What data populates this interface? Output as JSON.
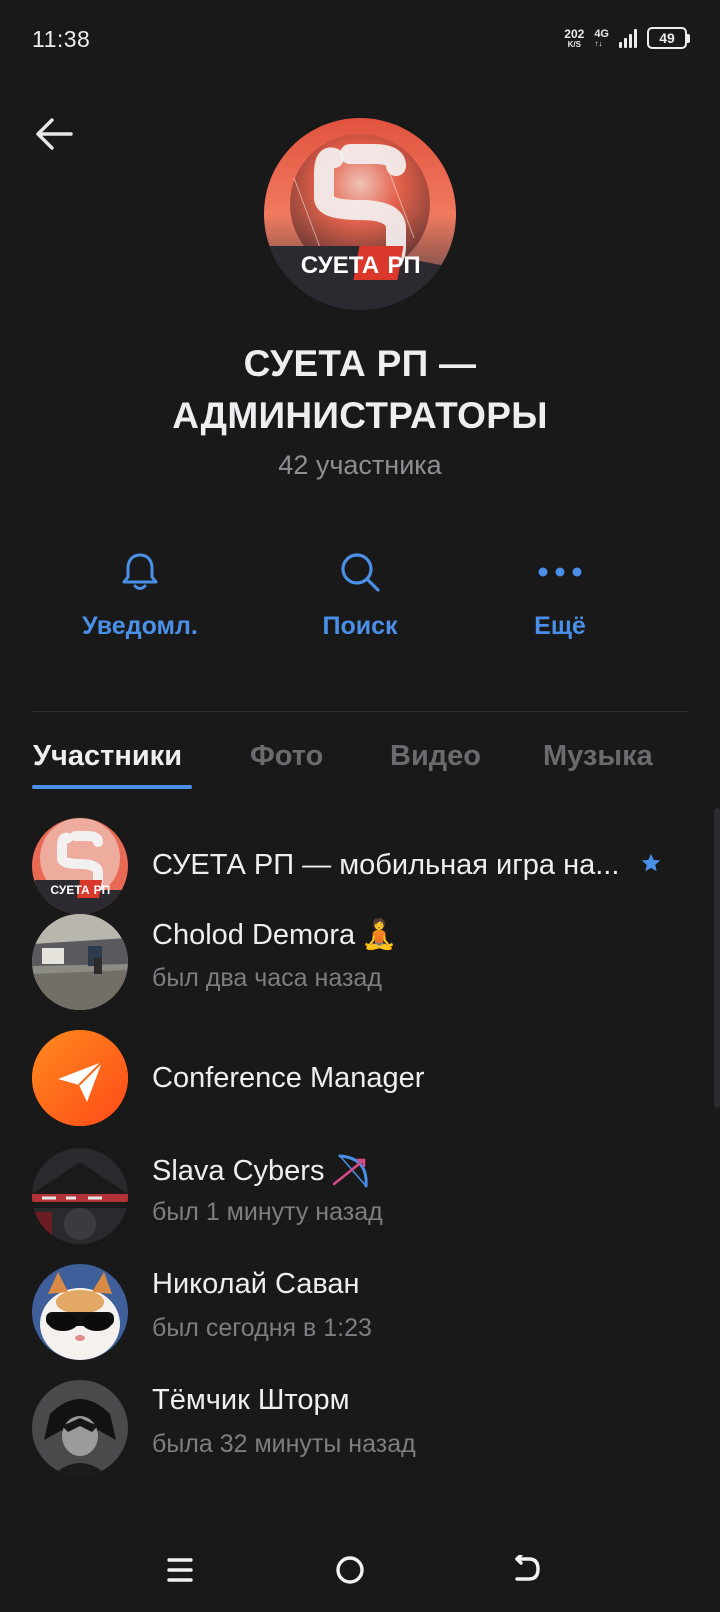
{
  "status_bar": {
    "time": "11:38",
    "net_speed": "202",
    "net_speed_unit": "K/S",
    "net_type": "4G",
    "net_arrows": "↑↓",
    "battery": "49"
  },
  "header": {
    "title": "СУЕТА РП — АДМИНИСТРАТОРЫ",
    "subtitle": "42 участника",
    "avatar_text": "СУЕТА",
    "avatar_text_accent": "РП"
  },
  "actions": [
    {
      "label": "Уведомл.",
      "icon": "bell-icon"
    },
    {
      "label": "Поиск",
      "icon": "search-icon"
    },
    {
      "label": "Ещё",
      "icon": "more-icon"
    }
  ],
  "tabs": [
    {
      "label": "Участники",
      "active": true
    },
    {
      "label": "Фото",
      "active": false
    },
    {
      "label": "Видео",
      "active": false
    },
    {
      "label": "Музыка",
      "active": false
    }
  ],
  "members": [
    {
      "name": "СУЕТА РП — мобильная игра на...",
      "status": "",
      "badge": "star-icon",
      "avatar_text": "СУЕТА",
      "avatar_text_accent": "РП"
    },
    {
      "name": "Cholod Demora",
      "emoji": "🧘",
      "status": "был два часа назад"
    },
    {
      "name": "Conference Manager",
      "status": ""
    },
    {
      "name": "Slava Cybers",
      "status": "был 1 минуту назад"
    },
    {
      "name": "Николай Саван",
      "status": "был сегодня в 1:23"
    },
    {
      "name": "Тёмчик Шторм",
      "status": "была 32 минуты назад"
    }
  ],
  "colors": {
    "background": "#19191a",
    "accent": "#4a8fe8",
    "conference_avatar": "#ff6a1a"
  }
}
